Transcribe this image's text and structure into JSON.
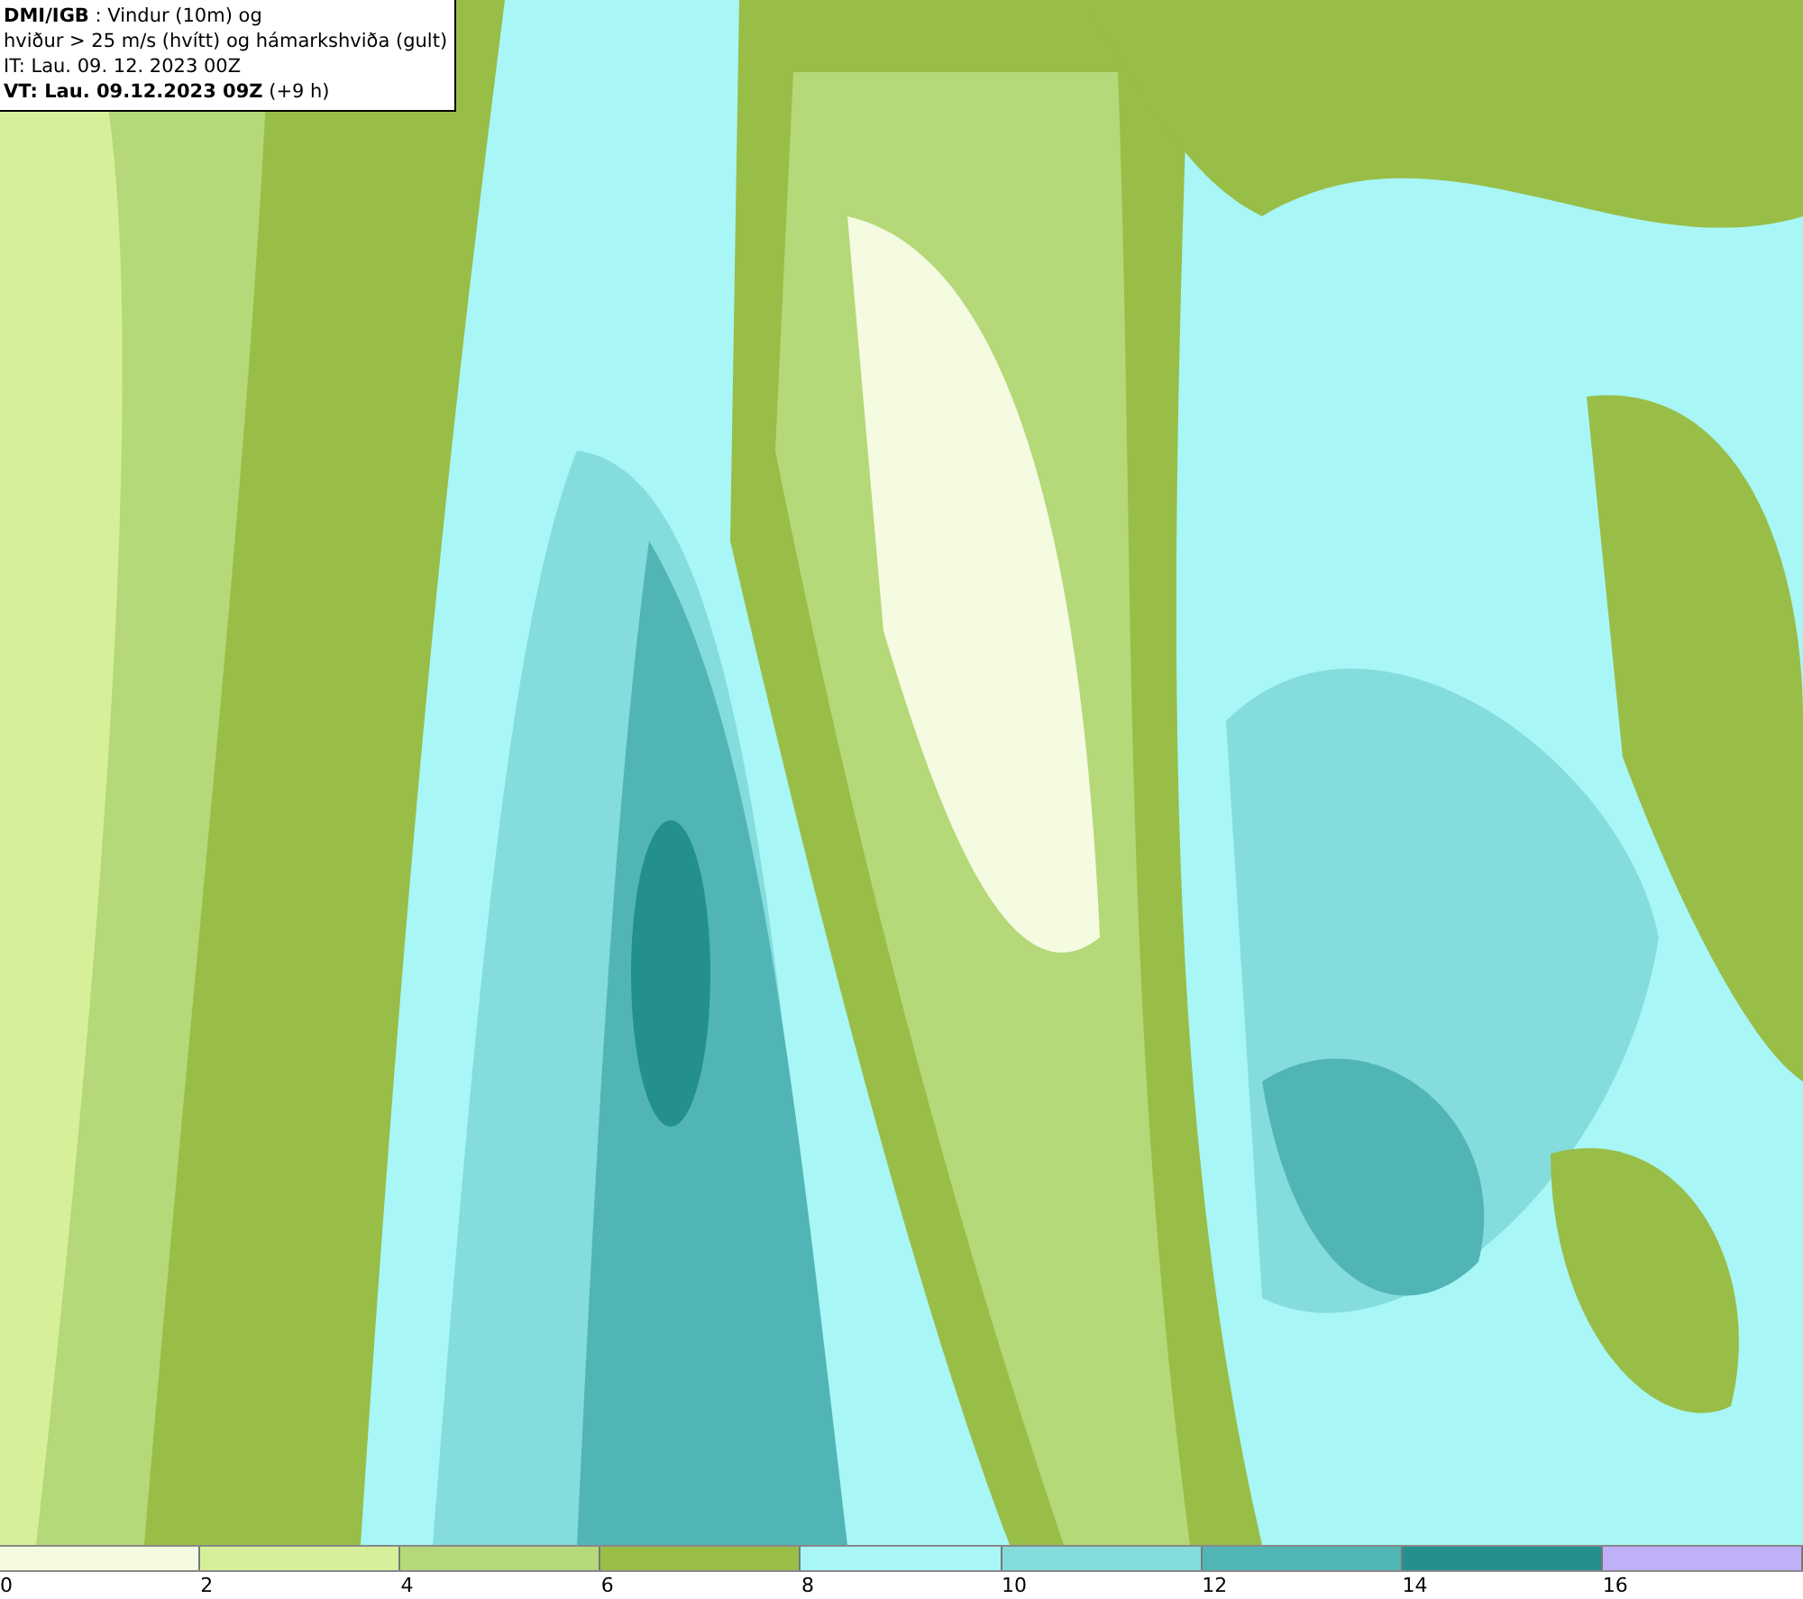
{
  "title_box": {
    "lines": [
      "**DMI/IGB** : Vindur (10m) og",
      "hviður > 25 m/s (hvítt) og hámarkshviða (gult)",
      "IT: Lau. 09. 12. 2023 00Z",
      "**VT: Lau. 09.12.2023 09Z** (+9 h)"
    ]
  },
  "legend": {
    "bins": [
      {
        "label": "0",
        "color": "#f4fbe0"
      },
      {
        "label": "2",
        "color": "#d6f09a"
      },
      {
        "label": "4",
        "color": "#b5d878"
      },
      {
        "label": "6",
        "color": "#98be48"
      },
      {
        "label": "8",
        "color": "#a8f6f6"
      },
      {
        "label": "10",
        "color": "#84dcdc"
      },
      {
        "label": "12",
        "color": "#52b5b5"
      },
      {
        "label": "14",
        "color": "#238f8f"
      },
      {
        "label": "16",
        "color": "#c0b0f8"
      }
    ]
  }
}
